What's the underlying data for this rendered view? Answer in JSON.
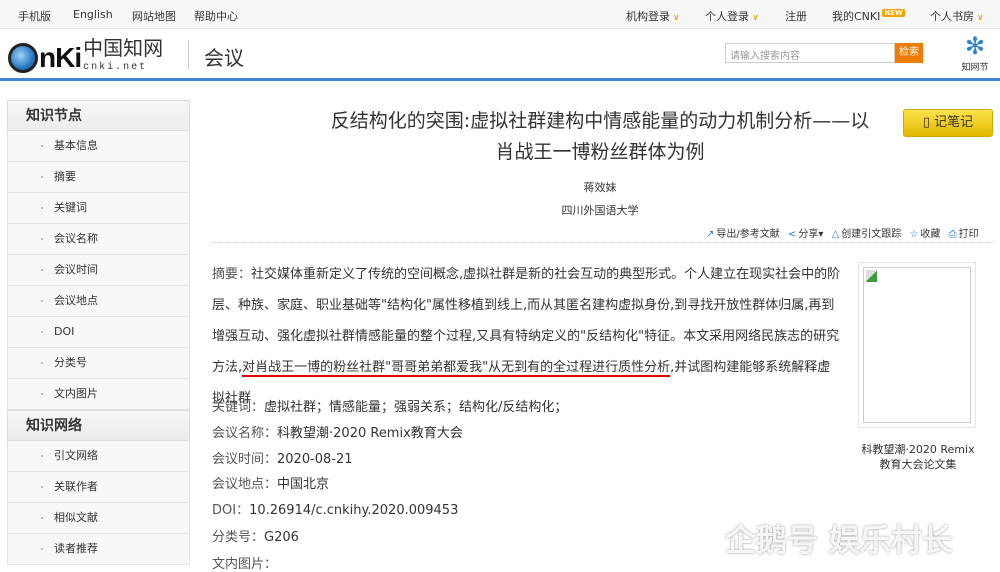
{
  "topbar": {
    "left": [
      "手机版",
      "English",
      "网站地图",
      "帮助中心"
    ],
    "org_login": "机构登录",
    "personal_login": "个人登录",
    "register": "注册",
    "my_cnki": "我的CNKI",
    "new_badge": "NEW",
    "bookshelf": "个人书房"
  },
  "header": {
    "logo": "CNKI 中国知网 cnki.net",
    "section": "会议",
    "search_placeholder": "请输入搜索内容",
    "search_button": "检索",
    "zhiwangjie": "知网节"
  },
  "sidebar": {
    "section1": "知识节点",
    "items1": [
      "基本信息",
      "摘要",
      "关键词",
      "会议名称",
      "会议时间",
      "会议地点",
      "DOI",
      "分类号",
      "文内图片"
    ],
    "section2": "知识网络",
    "items2": [
      "引文网络",
      "关联作者",
      "相似文献",
      "读者推荐"
    ]
  },
  "article": {
    "title_line1": "反结构化的突围:虚拟社群建构中情感能量的动力机制分析——以",
    "title_line2": "肖战王一博粉丝群体为例",
    "note_button": "记笔记",
    "author": "蒋效妹",
    "institution": "四川外国语大学",
    "tools": {
      "export": "导出/参考文献",
      "share": "分享",
      "track": "创建引文跟踪",
      "favorite": "收藏",
      "print": "打印"
    },
    "abstract_label": "摘要：",
    "abstract_pre": "社交媒体重新定义了传统的空间概念,虚拟社群是新的社会互动的典型形式。个人建立在现实社会中的阶层、种族、家庭、职业基础等\"结构化\"属性移植到线上,而从其匿名建构虚拟身份,到寻找开放性群体归属,再到增强互动、强化虚拟社群情感能量的整个过程,又具有特纳定义的\"反结构化\"特征。本文采用网络民族志的研究方法,",
    "abstract_highlight": "对肖战王一博的粉丝社群\"哥哥弟弟都爱我\"从无到有的全过程进行质性分析",
    "abstract_post": ",并试图构建能够系统解释虚拟社群",
    "fields": [
      {
        "label": "关键词：",
        "value": "虚拟社群；情感能量；强弱关系；结构化/反结构化；"
      },
      {
        "label": "会议名称：",
        "value": "科教望潮·2020 Remix教育大会"
      },
      {
        "label": "会议时间：",
        "value": "2020-08-21"
      },
      {
        "label": "会议地点：",
        "value": "中国北京"
      },
      {
        "label": "DOI：",
        "value": "10.26914/c.cnkihy.2020.009453"
      },
      {
        "label": "分类号：",
        "value": "G206"
      },
      {
        "label": "文内图片：",
        "value": ""
      }
    ],
    "cover_caption": "科教望潮·2020 Remix教育大会论文集"
  },
  "watermark": "企鹅号 娱乐村长"
}
